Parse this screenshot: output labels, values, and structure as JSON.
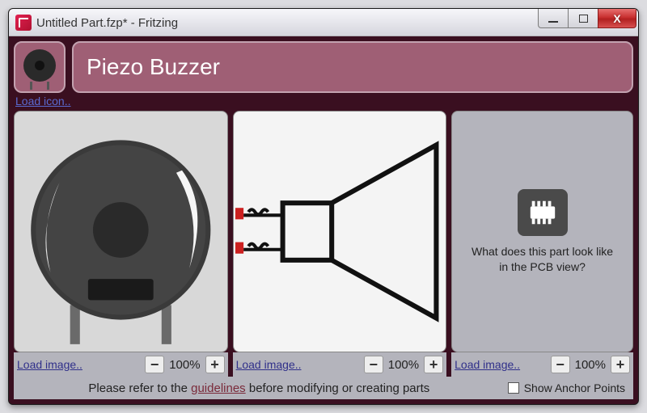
{
  "window": {
    "title": "Untitled Part.fzp* - Fritzing"
  },
  "header": {
    "part_name": "Piezo Buzzer",
    "load_icon_label": "Load icon.."
  },
  "panels": {
    "breadboard": {
      "load_label": "Load image..",
      "zoom": "100%"
    },
    "schematic": {
      "load_label": "Load image..",
      "zoom": "100%"
    },
    "pcb": {
      "load_label": "Load image..",
      "zoom": "100%",
      "placeholder_text": "What does this part look like in the PCB view?"
    }
  },
  "footer": {
    "prefix": "Please refer to the ",
    "link": "guidelines",
    "suffix": " before modifying or creating parts",
    "show_anchor_label": "Show Anchor Points"
  },
  "glyphs": {
    "minus": "−",
    "plus": "+",
    "close": "X"
  }
}
